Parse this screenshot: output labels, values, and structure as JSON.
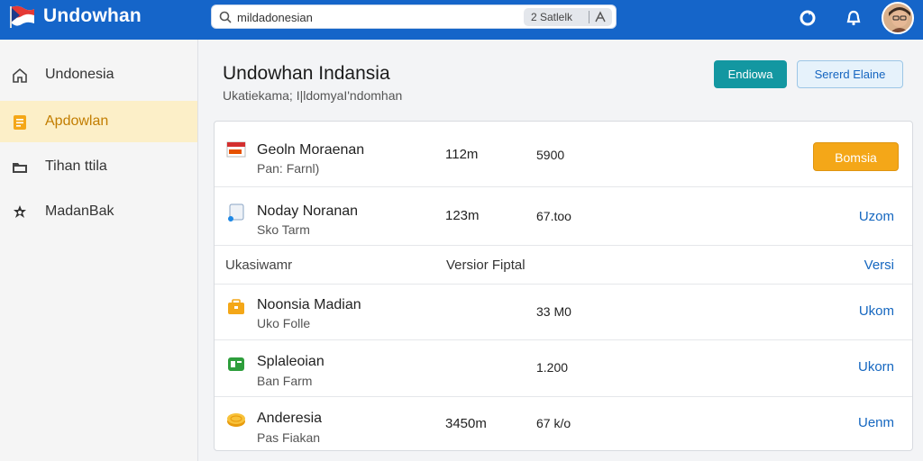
{
  "header": {
    "app_title": "Undowhan",
    "search": {
      "value": "mildadonesian",
      "filter_label": "2 Satlelk"
    }
  },
  "sidebar": {
    "items": [
      {
        "label": "Undonesia",
        "icon": "home-icon"
      },
      {
        "label": "Apdowlan",
        "icon": "document-icon"
      },
      {
        "label": "Tihan ttila",
        "icon": "folder-icon"
      },
      {
        "label": "MadanBak",
        "icon": "settings-icon"
      }
    ]
  },
  "page": {
    "title": "Undowhan Indansia",
    "subtitle": "Ukatiekama; I|ldomyaI'ndomhan",
    "primary_button": "Endiowa",
    "secondary_button": "Sererd Elaine"
  },
  "rows": [
    {
      "title": "Geoln Moraenan",
      "subtitle": "Pan: Farnl)",
      "col1": "112m",
      "col2": "5900",
      "action": "Bomsia",
      "icon": "flag-icon"
    },
    {
      "title": "Noday Noranan",
      "subtitle": "Sko Tarm",
      "col1": "123m",
      "col2": "67.too",
      "action": "Uzom",
      "icon": "file-icon"
    },
    {
      "header_label": "Ukasiwamr",
      "header_col": "Versior Fiptal",
      "action": "Versi"
    },
    {
      "title": "Noonsia Madian",
      "subtitle": "Uko Folle",
      "col1": "",
      "col2": "33 M0",
      "action": "Ukom",
      "icon": "briefcase-icon"
    },
    {
      "title": "Splaleoian",
      "subtitle": "Ban Farm",
      "col1": "",
      "col2": "1.200",
      "action": "Ukorn",
      "icon": "app-icon"
    },
    {
      "title": "Anderesia",
      "subtitle": "Pas Fiakan",
      "col1": "3450m",
      "col2": "67 k/o",
      "action": "Uenm",
      "icon": "coin-icon"
    }
  ],
  "colors": {
    "topbar": "#1565c9",
    "accent_teal": "#1397a1",
    "accent_orange": "#f4a718",
    "link": "#1567c0"
  }
}
